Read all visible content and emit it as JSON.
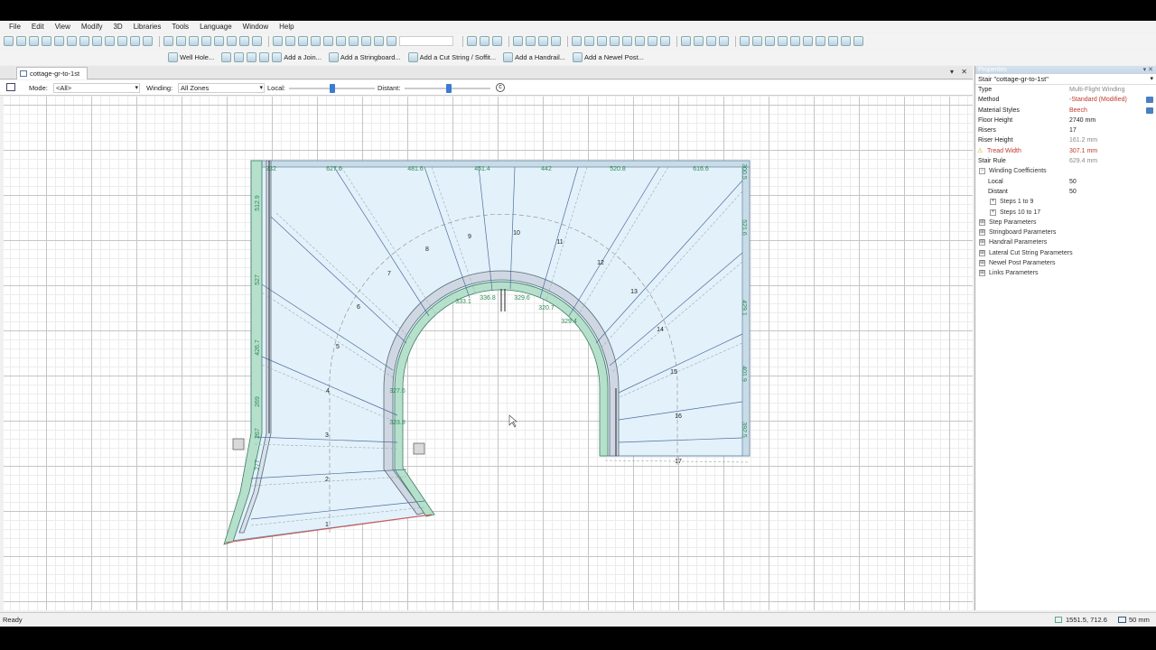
{
  "menu": [
    "File",
    "Edit",
    "View",
    "Modify",
    "3D",
    "Libraries",
    "Tools",
    "Language",
    "Window",
    "Help"
  ],
  "toolbar2": {
    "items": [
      "Well Hole...",
      "Add a Join...",
      "Add a Stringboard...",
      "Add a Cut String / Soffit...",
      "Add a Handrail...",
      "Add a Newel Post..."
    ]
  },
  "document": {
    "tab_title": "cottage-gr-to-1st",
    "menu_icon": "chevron-down-icon",
    "close_icon": "close-icon"
  },
  "modebar": {
    "mode_label": "Mode:",
    "mode_value": "<All>",
    "winding_label": "Winding:",
    "winding_value": "All Zones",
    "local_label": "Local:",
    "distant_label": "Distant:",
    "local_value": 50,
    "distant_value": 50
  },
  "drawing": {
    "top_dims": [
      "232",
      "627.6",
      "481.6",
      "451.4",
      "442",
      "520.8",
      "616.6"
    ],
    "right_dims": [
      "300.5",
      "521.6",
      "429.1",
      "401.9",
      "392.5"
    ],
    "left_dims": [
      "512.9",
      "527",
      "426.7",
      "269",
      "267",
      "277"
    ],
    "inner_dims": [
      "333.1",
      "336.8",
      "329.6",
      "320.7",
      "329.4",
      "327.6",
      "323.8"
    ],
    "step_numbers": [
      "1",
      "2",
      "3",
      "4",
      "5",
      "6",
      "7",
      "8",
      "9",
      "10",
      "11",
      "12",
      "13",
      "14",
      "15",
      "16",
      "17"
    ]
  },
  "properties": {
    "title": "Properties",
    "selected": "Stair \"cottage-gr-to-1st\"",
    "rows": [
      {
        "key": "Type",
        "value": "Multi-Flight Winding",
        "style": "grey"
      },
      {
        "key": "Method",
        "value": "-Standard (Modified)",
        "style": "red",
        "button": true
      },
      {
        "key": "Material Styles",
        "value": "Beech",
        "style": "red",
        "button": true
      },
      {
        "key": "Floor Height",
        "value": "2740 mm",
        "style": ""
      },
      {
        "key": "Risers",
        "value": "17",
        "style": ""
      },
      {
        "key": "Riser Height",
        "value": "161.2 mm",
        "style": "grey"
      },
      {
        "key": "Tread Width",
        "value": "307.1 mm",
        "style": "red",
        "warn": true
      },
      {
        "key": "Stair Rule",
        "value": "629.4 mm",
        "style": "grey"
      }
    ],
    "winding_coefficients": "Winding Coefficients",
    "winding_rows": [
      {
        "key": "Local",
        "value": "50"
      },
      {
        "key": "Distant",
        "value": "50"
      }
    ],
    "subcats": [
      "Steps 1 to 9",
      "Steps 10 to 17"
    ],
    "categories": [
      "Step Parameters",
      "Stringboard Parameters",
      "Handrail Parameters",
      "Lateral Cut String Parameters",
      "Newel Post Parameters",
      "Links Parameters"
    ]
  },
  "status": {
    "ready": "Ready",
    "coords": "1551.5, 712.6",
    "scale": "50 mm"
  }
}
